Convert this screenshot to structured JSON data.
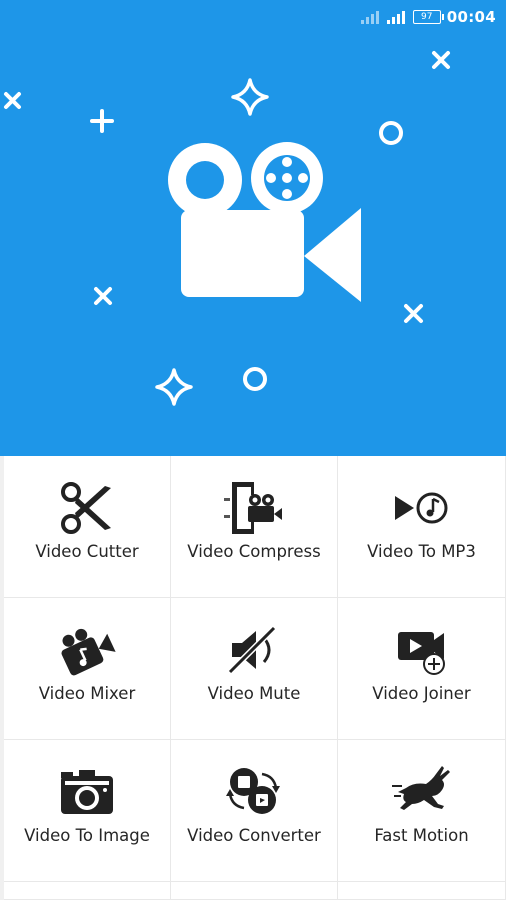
{
  "status_bar": {
    "battery": "97",
    "time": "00:04"
  },
  "hero": {
    "logo_icon": "video-camera-film-reel-icon",
    "background": "#1e96e8"
  },
  "tools": [
    {
      "label": "Video Cutter",
      "icon": "scissors-icon"
    },
    {
      "label": "Video Compress",
      "icon": "clamp-camera-icon"
    },
    {
      "label": "Video To MP3",
      "icon": "play-music-note-icon"
    },
    {
      "label": "Video Mixer",
      "icon": "camera-music-note-icon"
    },
    {
      "label": "Video Mute",
      "icon": "muted-speaker-icon"
    },
    {
      "label": "Video Joiner",
      "icon": "video-add-icon"
    },
    {
      "label": "Video To Image",
      "icon": "photo-camera-icon"
    },
    {
      "label": "Video Converter",
      "icon": "convert-arrows-icon"
    },
    {
      "label": "Fast Motion",
      "icon": "running-rabbit-icon"
    }
  ]
}
